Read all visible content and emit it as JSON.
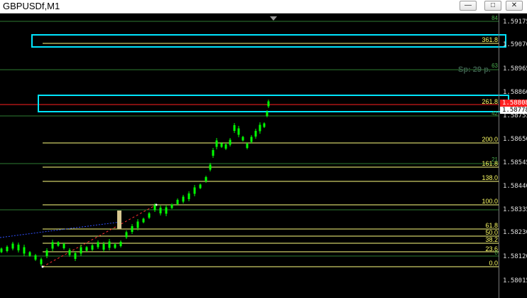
{
  "window": {
    "title": "GBPUSDf,M1",
    "minimize_icon": "minimize-icon",
    "restore_icon": "restore-icon",
    "close_icon": "close-icon"
  },
  "price_axis": {
    "labels": [
      "1.59175",
      "1.59070",
      "1.58965",
      "1.58860",
      "1.58755",
      "1.58650",
      "1.58545",
      "1.58440",
      "1.58335",
      "1.58230",
      "1.58120",
      "1.58015"
    ],
    "bid_tag": "1.58778",
    "ask_tag": "1.58808"
  },
  "spread": "Sp: 29 p.",
  "fib_levels": [
    "361.8",
    "261.8",
    "200.0",
    "161.8",
    "138.0",
    "100.0",
    "61.8",
    "50.0",
    "38.2",
    "23.6",
    "0.0"
  ],
  "grid_levels": [
    "84",
    "63",
    "42",
    "21",
    "0"
  ],
  "colors": {
    "background": "#000000",
    "candle": "#00ff00",
    "fib_line": "#ffff66",
    "highlight_box": "#00e5ff",
    "green_level": "#2e7d32",
    "bid_line": "#ff2020",
    "ask_tag": "#ff2020"
  }
}
